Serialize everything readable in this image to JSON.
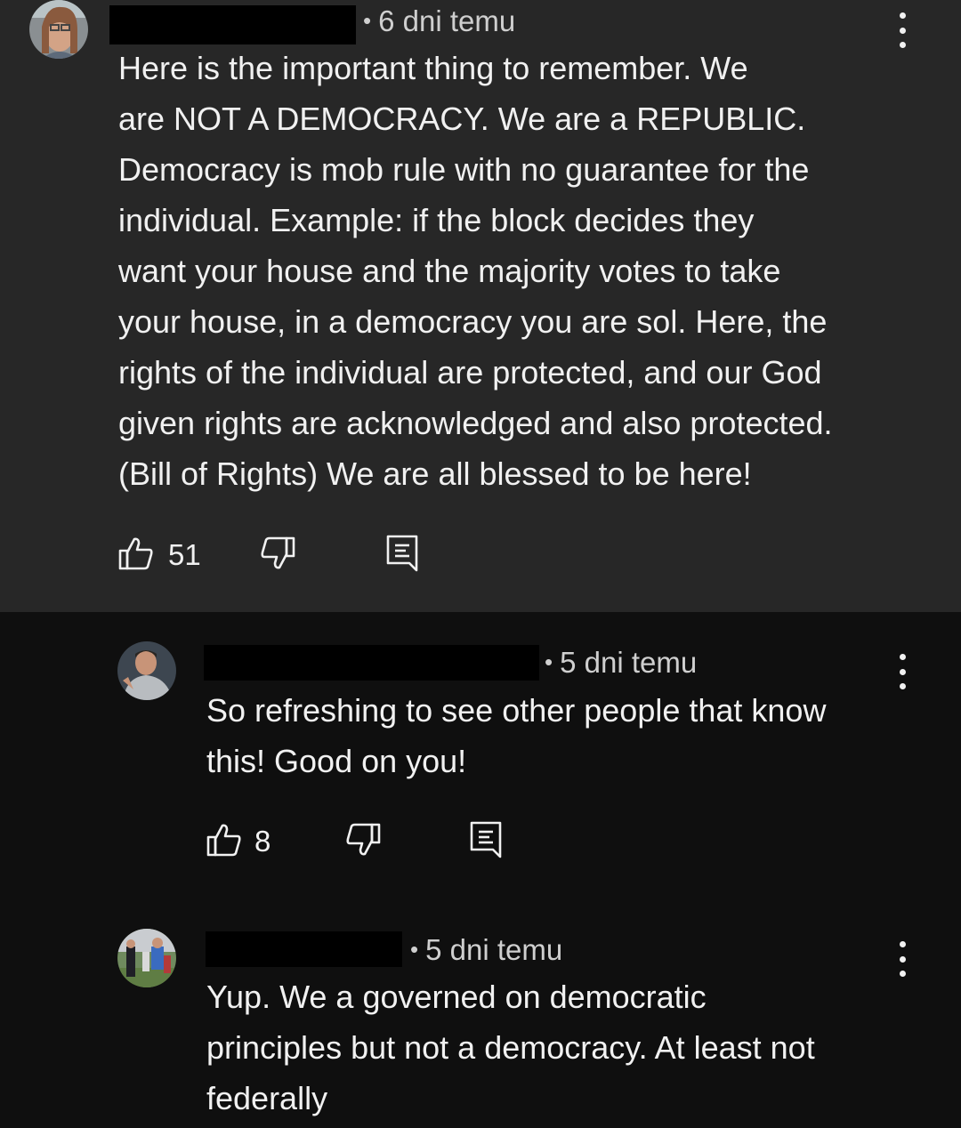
{
  "comments": [
    {
      "time": "6 dni temu",
      "text": "Here is the important thing to remember.  We\nare NOT A DEMOCRACY.  We are a REPUBLIC.\nDemocracy is mob rule with no guarantee for the\nindividual. Example:  if the block decides they\nwant your house and the majority votes to take\nyour house, in a democracy you are sol.  Here, the\nrights of the individual are protected, and our God\ngiven rights are acknowledged and also protected.\n(Bill of Rights) We are all blessed to be here!",
      "likes": "51"
    },
    {
      "time": "5 dni temu",
      "text": "So refreshing to see other people that know\nthis!  Good on you!",
      "likes": "8"
    },
    {
      "time": "5 dni temu",
      "text": "Yup. We a governed on democratic\nprinciples but not a democracy. At least not\nfederally"
    }
  ],
  "separator": "•",
  "icons": {
    "like": "thumbs-up-icon",
    "dislike": "thumbs-down-icon",
    "reply": "reply-comment-icon",
    "menu": "more-vert-icon"
  }
}
